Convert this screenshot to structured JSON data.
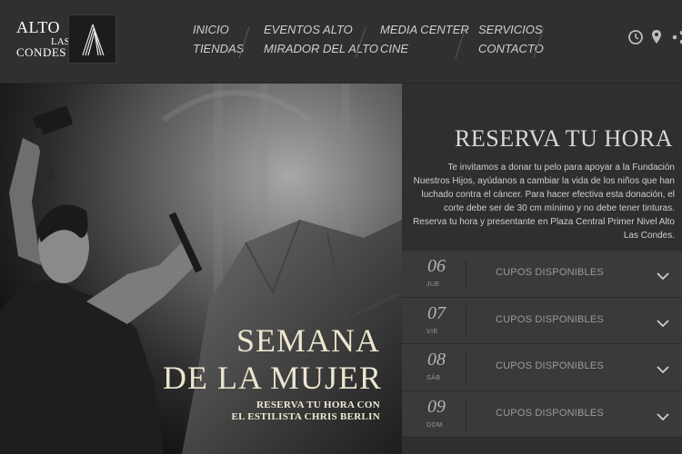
{
  "logo": {
    "line1": "ALTO",
    "line2": "LAS",
    "line3": "CONDES"
  },
  "nav": [
    [
      "INICIO",
      "TIENDAS"
    ],
    [
      "EVENTOS ALTO",
      "MIRADOR DEL ALTO"
    ],
    [
      "MEDIA CENTER",
      "CINE"
    ],
    [
      "SERVICIOS",
      "CONTACTO"
    ]
  ],
  "header_icons": [
    "clock-icon",
    "location-pin-icon",
    "share-icon"
  ],
  "hero": {
    "title_line1": "SEMANA",
    "title_line2": "DE LA MUJER",
    "subtitle_line1": "RESERVA TU HORA CON",
    "subtitle_line2": "EL ESTILISTA CHRIS BERLIN"
  },
  "panel": {
    "title": "RESERVA TU HORA",
    "description": "Te invitamos a donar tu pelo para apoyar a la Fundación Nuestros Hijos, ayúdanos a cambiar la vida de los niños que han luchado contra el cáncer. Para hacer efectiva esta donación, el corte debe ser de 30 cm mínimo y no debe tener tinturas. Reserva tu hora y presentante en Plaza Central Primer Nivel Alto Las Condes."
  },
  "slots": [
    {
      "day": "06",
      "dow": "JUE",
      "label": "CUPOS DISPONIBLES"
    },
    {
      "day": "07",
      "dow": "VIE",
      "label": "CUPOS DISPONIBLES"
    },
    {
      "day": "08",
      "dow": "SÁB",
      "label": "CUPOS DISPONIBLES"
    },
    {
      "day": "09",
      "dow": "DOM",
      "label": "CUPOS DISPONIBLES"
    }
  ],
  "colors": {
    "header_bg": "#303030",
    "panel_bg": "#2f2f2f",
    "slot_bg": "#3a3a3a",
    "hero_text": "#ece6cf"
  }
}
